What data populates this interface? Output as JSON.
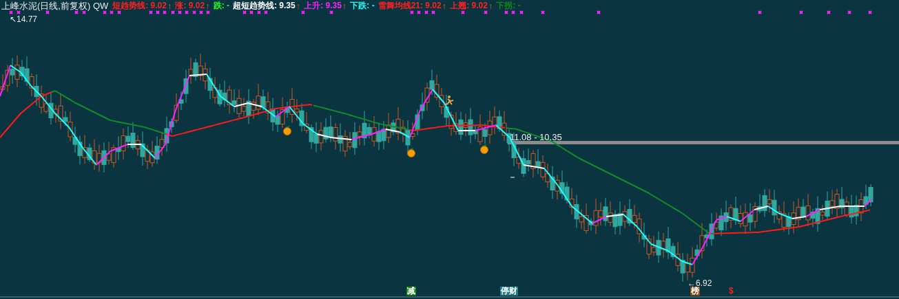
{
  "chart": {
    "title": "上峰水泥(日线,前复权) QW",
    "legend": [
      {
        "label": "短趋势线:",
        "value": "9.02",
        "color": "#ff2020",
        "arrow": "↑"
      },
      {
        "label": "涨:",
        "value": "9.02",
        "color": "#ff2020",
        "arrow": "↑"
      },
      {
        "label": "跌:",
        "value": "-",
        "color": "#20ff20"
      },
      {
        "label": "超短趋势线:",
        "value": "9.35",
        "color": "#ffffff",
        "arrow": "↑"
      },
      {
        "label": "上升:",
        "value": "9.35",
        "color": "#ff20ff",
        "arrow": "↑"
      },
      {
        "label": "下跌:",
        "value": "-",
        "color": "#20ffff"
      },
      {
        "label": "雪舞均线21:",
        "value": "9.02",
        "color": "#ff2020",
        "arrow": "↑"
      },
      {
        "label": "上翘:",
        "value": "9.02",
        "color": "#ff2020",
        "arrow": "↑"
      },
      {
        "label": "下拐:",
        "value": "-",
        "color": "#118811"
      }
    ],
    "high_label": "↖14.77",
    "low_label": "←6.92",
    "range_label": "11.08 - 10.35",
    "markers": [
      {
        "text": "减",
        "color": "#118811"
      },
      {
        "text": "停财",
        "color": "#1a7f86"
      },
      {
        "text": "榜",
        "color": "#8a4a12"
      },
      {
        "text": "$",
        "color": "#ff2020"
      }
    ]
  }
}
